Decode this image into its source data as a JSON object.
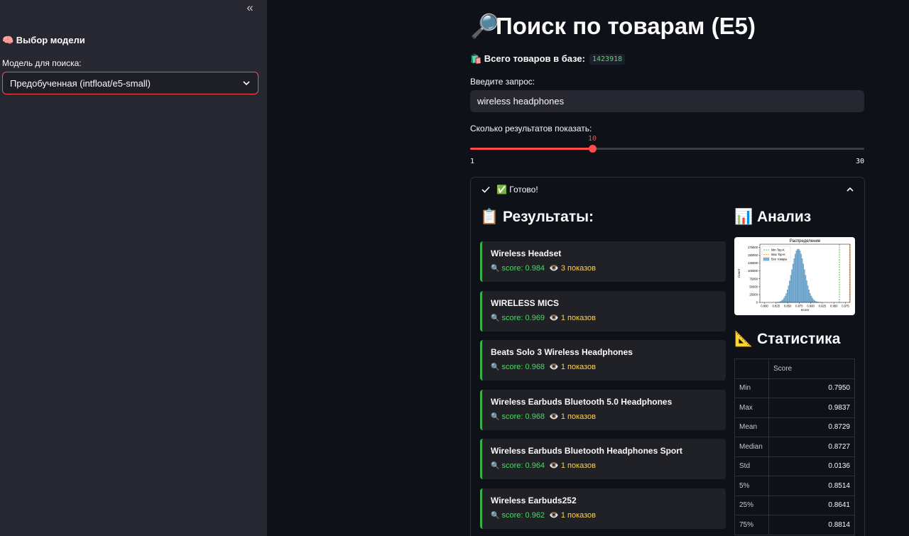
{
  "sidebar": {
    "heading": "🧠 Выбор модели",
    "model_label": "Модель для поиска:",
    "model_value": "Предобученная (intfloat/e5-small)"
  },
  "header": {
    "title": "Поиск по товарам (E5)",
    "title_icon": "🔎",
    "total_label": "🛍️ Всего товаров в базе:",
    "total_value": "1423918"
  },
  "query": {
    "label": "Введите запрос:",
    "value": "wireless headphones"
  },
  "count": {
    "label": "Сколько результатов показать:",
    "value": "10",
    "min": "1",
    "max": "30"
  },
  "status": {
    "label": "✅ Готово!"
  },
  "results": {
    "title": "📋 Результаты:",
    "items": [
      {
        "name": "Wireless Headset",
        "score": "score: 0.984",
        "views": "3 показов"
      },
      {
        "name": "WIRELESS MICS",
        "score": "score: 0.969",
        "views": "1 показов"
      },
      {
        "name": "Beats Solo 3 Wireless Headphones",
        "score": "score: 0.968",
        "views": "1 показов"
      },
      {
        "name": "Wireless Earbuds Bluetooth 5.0 Headphones",
        "score": "score: 0.968",
        "views": "1 показов"
      },
      {
        "name": "Wireless Earbuds Bluetooth Headphones Sport",
        "score": "score: 0.964",
        "views": "1 показов"
      },
      {
        "name": "Wireless Earbuds252",
        "score": "score: 0.962",
        "views": "1 показов"
      }
    ]
  },
  "analysis": {
    "title": "📊 Анализ"
  },
  "stats": {
    "title": "📐 Статистика",
    "column": "Score",
    "rows": [
      {
        "k": "Min",
        "v": "0.7950"
      },
      {
        "k": "Max",
        "v": "0.9837"
      },
      {
        "k": "Mean",
        "v": "0.8729"
      },
      {
        "k": "Median",
        "v": "0.8727"
      },
      {
        "k": "Std",
        "v": "0.0136"
      },
      {
        "k": "5%",
        "v": "0.8514"
      },
      {
        "k": "25%",
        "v": "0.8641"
      },
      {
        "k": "75%",
        "v": "0.8814"
      }
    ]
  },
  "chart_data": {
    "type": "bar",
    "title": "Распределение",
    "xlabel": "Score",
    "ylabel": "Count",
    "xlim": [
      0.79,
      0.985
    ],
    "ylim": [
      0,
      185000
    ],
    "x_ticks": [
      "0.800",
      "0.825",
      "0.850",
      "0.875",
      "0.900",
      "0.925",
      "0.950",
      "0.975"
    ],
    "y_ticks": [
      "0",
      "25000",
      "50000",
      "75000",
      "100000",
      "125000",
      "150000",
      "175000"
    ],
    "legend": [
      "Min Top-K",
      "Max Top-K",
      "Все товары"
    ],
    "legend_position": "top-left",
    "mean": 0.8729,
    "std": 0.0136,
    "peak_count": 170000,
    "min_topk": 0.962,
    "max_topk": 0.984,
    "colors": {
      "bars": "#7fb2d6",
      "min_line": "#2ca02c",
      "max_line": "#ff7f0e"
    }
  }
}
